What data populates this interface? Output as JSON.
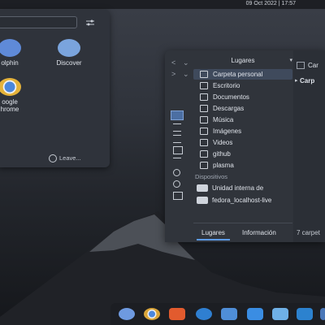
{
  "topbar": {
    "clock": "09 Oct 2022 | 17:57"
  },
  "launcher": {
    "apps": [
      {
        "label": "olphin",
        "icon": "dolphin-icon",
        "color": "#5f8ad8"
      },
      {
        "label": "Discover",
        "icon": "discover-icon",
        "color": "#7aa4dd"
      },
      {
        "label": "oogle\nhrome",
        "icon": "chrome-icon",
        "color": "#e4b23a"
      }
    ],
    "leave_label": "Leave..."
  },
  "file_manager": {
    "places_title": "Lugares",
    "right_title": "Car",
    "right_breadcrumb": "Carp",
    "places": [
      {
        "label": "Carpeta personal",
        "icon": "home-icon",
        "selected": true
      },
      {
        "label": "Escritorio",
        "icon": "desktop-icon"
      },
      {
        "label": "Documentos",
        "icon": "documents-icon"
      },
      {
        "label": "Descargas",
        "icon": "downloads-icon"
      },
      {
        "label": "Música",
        "icon": "music-icon"
      },
      {
        "label": "Imágenes",
        "icon": "images-icon"
      },
      {
        "label": "Videos",
        "icon": "videos-icon"
      },
      {
        "label": "github",
        "icon": "folder-icon"
      },
      {
        "label": "plasma",
        "icon": "folder-icon"
      }
    ],
    "devices_header": "Dispositivos",
    "devices": [
      {
        "label": "Unidad interna de",
        "icon": "drive-icon"
      },
      {
        "label": "fedora_localhost-live",
        "icon": "drive-icon"
      }
    ],
    "tabs": [
      {
        "label": "Lugares",
        "active": true
      },
      {
        "label": "Información",
        "active": false
      }
    ],
    "status_text": "7 carpet"
  },
  "dock": [
    {
      "name": "dolphin-icon",
      "color": "#6e9ae0"
    },
    {
      "name": "chrome-icon",
      "color": "#d9a53a"
    },
    {
      "name": "gitlab-icon",
      "color": "#e25b2e"
    },
    {
      "name": "settings-icon",
      "color": "#2f7fd1"
    },
    {
      "name": "screen-icon",
      "color": "#4f8ed8"
    },
    {
      "name": "toolbox-icon",
      "color": "#3a8de3"
    },
    {
      "name": "weather-icon",
      "color": "#6fb0e6"
    },
    {
      "name": "vscode-icon",
      "color": "#2c82cf"
    },
    {
      "name": "extra-icon",
      "color": "#4a77b8"
    }
  ]
}
